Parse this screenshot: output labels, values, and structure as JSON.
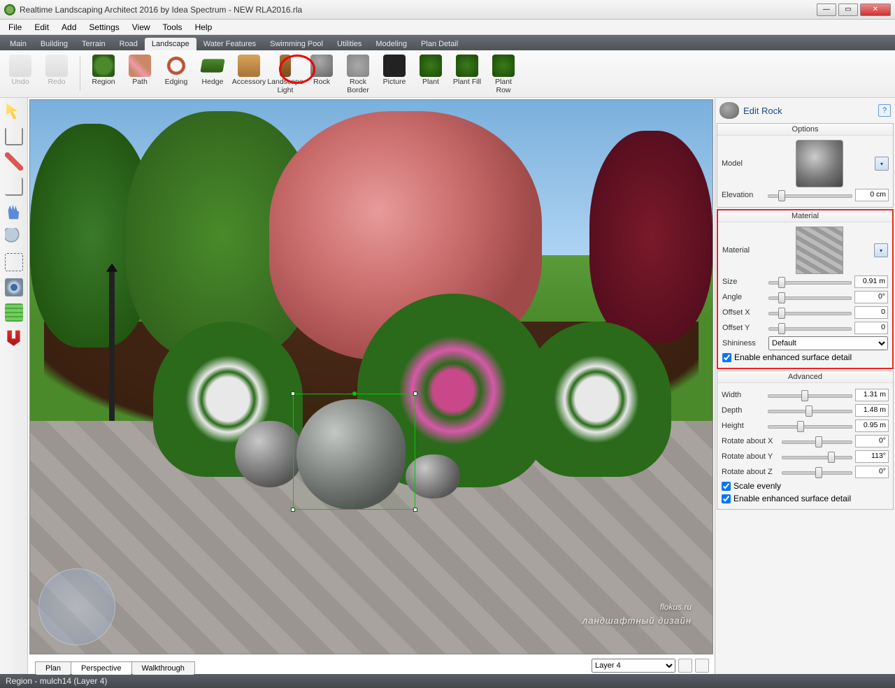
{
  "window": {
    "title": "Realtime Landscaping Architect 2016 by Idea Spectrum - NEW RLA2016.rla"
  },
  "menu": [
    "File",
    "Edit",
    "Add",
    "Settings",
    "View",
    "Tools",
    "Help"
  ],
  "tabs": [
    "Main",
    "Building",
    "Terrain",
    "Road",
    "Landscape",
    "Water Features",
    "Swimming Pool",
    "Utilities",
    "Modeling",
    "Plan Detail"
  ],
  "active_tab": "Landscape",
  "toolbar": {
    "undo": "Undo",
    "redo": "Redo",
    "region": "Region",
    "path": "Path",
    "edging": "Edging",
    "hedge": "Hedge",
    "accessory": "Accessory",
    "light": "Landscape Light",
    "rock": "Rock",
    "rockborder": "Rock Border",
    "picture": "Picture",
    "plant": "Plant",
    "plantfill": "Plant Fill",
    "plantrow": "Plant Row"
  },
  "view_tabs": [
    "Plan",
    "Perspective",
    "Walkthrough"
  ],
  "active_view": "Perspective",
  "layer": {
    "selected": "Layer 4"
  },
  "panel": {
    "title": "Edit Rock",
    "help": "?",
    "options": {
      "header": "Options",
      "model_label": "Model",
      "elevation_label": "Elevation",
      "elevation_value": "0 cm"
    },
    "material": {
      "header": "Material",
      "material_label": "Material",
      "size_label": "Size",
      "size_value": "0.91 m",
      "angle_label": "Angle",
      "angle_value": "0°",
      "offx_label": "Offset X",
      "offx_value": "0",
      "offy_label": "Offset Y",
      "offy_value": "0",
      "shininess_label": "Shininess",
      "shininess_value": "Default",
      "enhanced_label": "Enable enhanced surface detail"
    },
    "advanced": {
      "header": "Advanced",
      "width_label": "Width",
      "width_value": "1.31 m",
      "depth_label": "Depth",
      "depth_value": "1.48 m",
      "height_label": "Height",
      "height_value": "0.95 m",
      "rotx_label": "Rotate about X",
      "rotx_value": "0°",
      "roty_label": "Rotate about Y",
      "roty_value": "113°",
      "rotz_label": "Rotate about Z",
      "rotz_value": "0°",
      "scale_label": "Scale evenly",
      "enhanced_label": "Enable enhanced surface detail"
    }
  },
  "status": "Region - mulch14 (Layer 4)",
  "watermark": {
    "main": "flokus.ru",
    "sub": "ландшафтный дизайн"
  }
}
